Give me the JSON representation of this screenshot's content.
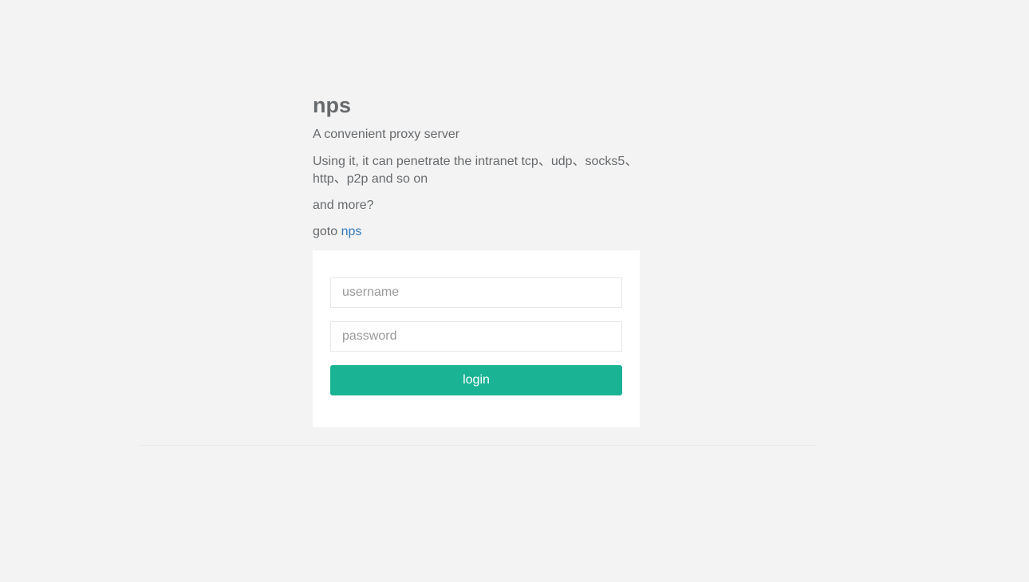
{
  "header": {
    "title": "nps",
    "subtitle": "A convenient proxy server",
    "description": "Using it, it can penetrate the intranet tcp、udp、socks5、http、p2p and so on",
    "more": "and more?",
    "goto_prefix": "goto ",
    "goto_link": "nps"
  },
  "login_form": {
    "username_placeholder": "username",
    "username_value": "",
    "password_placeholder": "password",
    "password_value": "",
    "login_label": "login"
  },
  "colors": {
    "background": "#f3f3f4",
    "panel": "#ffffff",
    "accent": "#1ab394",
    "link": "#337ab7",
    "text": "#676a6c"
  }
}
